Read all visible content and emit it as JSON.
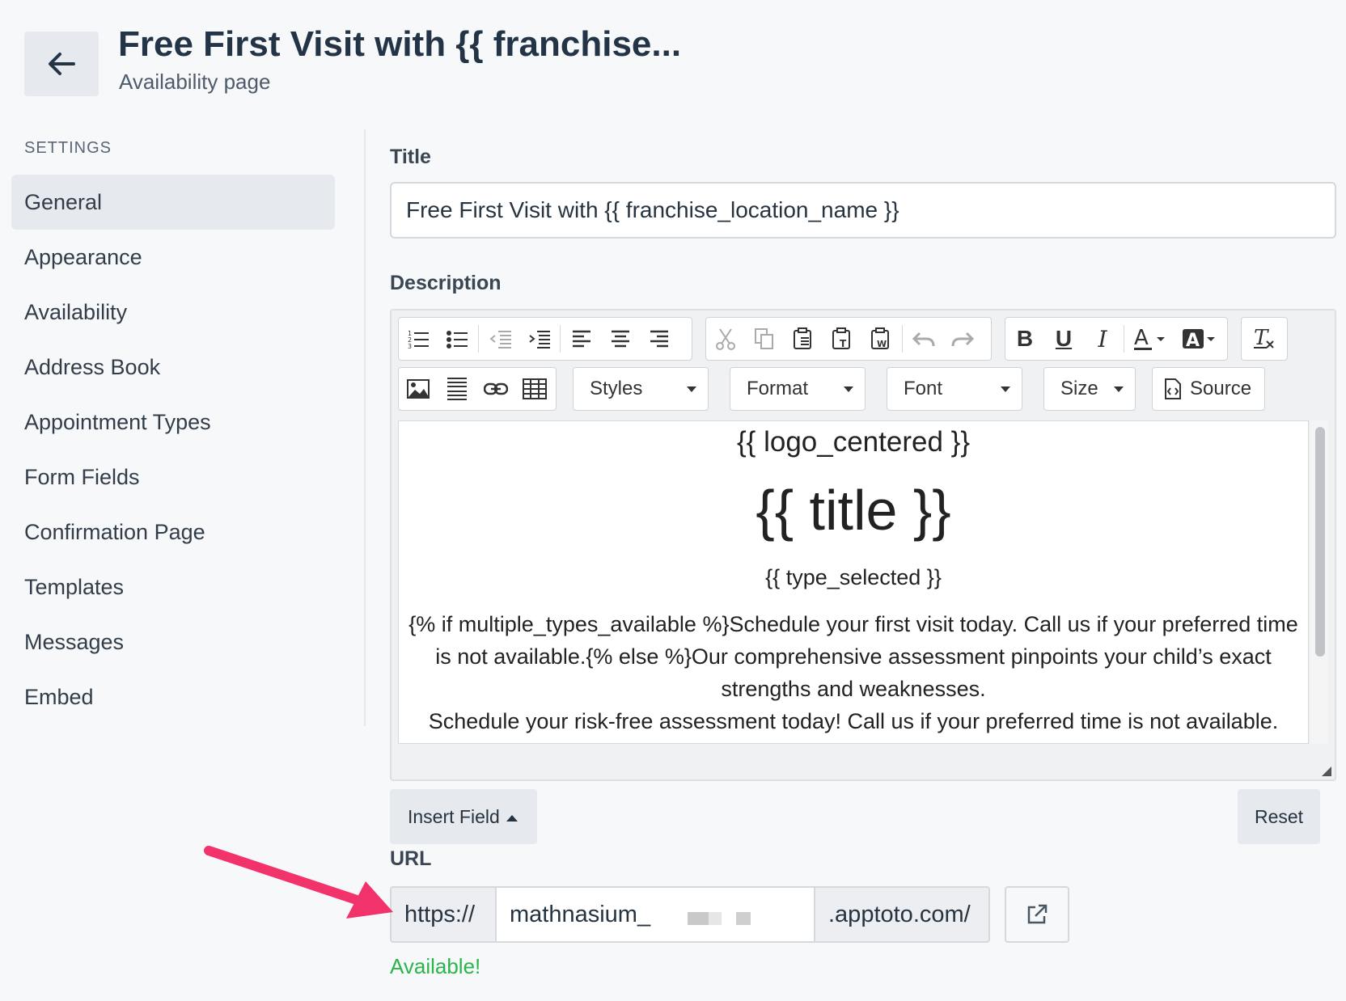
{
  "header": {
    "title": "Free First Visit with {{ franchise...",
    "subtitle": "Availability page"
  },
  "sidebar": {
    "heading": "SETTINGS",
    "items": [
      {
        "label": "General",
        "active": true
      },
      {
        "label": "Appearance"
      },
      {
        "label": "Availability"
      },
      {
        "label": "Address Book"
      },
      {
        "label": "Appointment Types"
      },
      {
        "label": "Form Fields"
      },
      {
        "label": "Confirmation Page"
      },
      {
        "label": "Templates"
      },
      {
        "label": "Messages"
      },
      {
        "label": "Embed"
      }
    ]
  },
  "form": {
    "title_label": "Title",
    "title_value": "Free First Visit with {{ franchise_location_name }}",
    "description_label": "Description",
    "toolbar": {
      "styles": "Styles",
      "format": "Format",
      "font": "Font",
      "size": "Size",
      "source": "Source"
    },
    "editor": {
      "logo": "{{ logo_centered }}",
      "title": "{{ title }}",
      "type": "{{ type_selected }}",
      "paragraph": "{% if multiple_types_available %}Schedule your first visit today.  Call us if your preferred time is not available.{% else %}Our comprehensive assessment pinpoints your child’s exact strengths and weaknesses.",
      "paragraph2": "Schedule your risk-free assessment today! Call us if your preferred time is not available."
    },
    "insert_field": "Insert Field",
    "reset": "Reset",
    "url_label": "URL",
    "url_prefix": "https://",
    "url_value": "mathnasium_",
    "url_suffix": ".apptoto.com/",
    "url_status": "Available!"
  },
  "colors": {
    "accent_arrow": "#f2336b",
    "status_ok": "#2ab44b"
  }
}
